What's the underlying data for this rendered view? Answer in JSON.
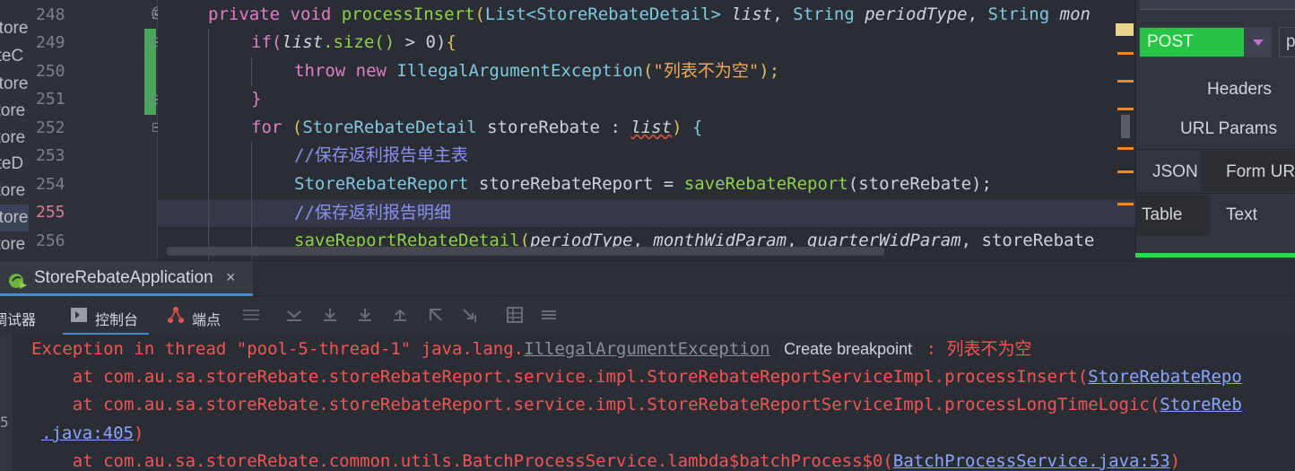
{
  "project_tree": {
    "items": [
      {
        "label": "Store",
        "selected": false
      },
      {
        "label": "ateC",
        "selected": false
      },
      {
        "label": "Store",
        "selected": false
      },
      {
        "label": "store",
        "selected": false
      },
      {
        "label": "store",
        "selected": false
      },
      {
        "label": "ateD",
        "selected": false
      },
      {
        "label": "store",
        "selected": false
      },
      {
        "label": "Store",
        "selected": true
      },
      {
        "label": "store",
        "selected": false
      }
    ]
  },
  "editor": {
    "line_numbers": [
      "248",
      "249",
      "250",
      "251",
      "252",
      "253",
      "254",
      "255",
      "256"
    ],
    "current_line": "255",
    "gutter_annotation": "@",
    "code": {
      "l248": {
        "kw": "private void",
        "fn": "processInsert",
        "open": "(",
        "type1": "List<StoreRebateDetail>",
        "p1": "list",
        "comma1": ",",
        "type2": "String",
        "p2": "periodType",
        "comma2": ",",
        "type3": "String",
        "p3": "mon"
      },
      "l249": {
        "kw": "if",
        "open": "(",
        "var": "list",
        "call": ".size()",
        "rest": " > 0)",
        "brace": "{"
      },
      "l250": {
        "kw": "throw new",
        "type": "IllegalArgumentException",
        "open": "(",
        "str": "\"列表不为空\"",
        "close": ");"
      },
      "l251": {
        "brace": "}"
      },
      "l252": {
        "kw": "for",
        "open": "(",
        "type": "StoreRebateDetail",
        "var": "storeRebate",
        "colon": ":",
        "iter": "list",
        "close": ")",
        "brace": "{"
      },
      "l253": {
        "comment": "//保存返利报告单主表"
      },
      "l254": {
        "type": "StoreRebateReport",
        "var": "storeRebateReport",
        "eq": "=",
        "fn": "saveRebateReport",
        "arg": "(storeRebate);"
      },
      "l255": {
        "comment": "//保存返利报告明细"
      },
      "l256": {
        "fn": "saveReportRebateDetail",
        "open": "(",
        "a1": "periodType",
        "a2": "monthWidParam",
        "a3": "quarterWidParam",
        "a4": "storeRebate"
      }
    }
  },
  "http_client": {
    "method": "POST",
    "url_partial": "p",
    "tabs_row1": [
      "Headers"
    ],
    "tabs_row2": [
      "URL Params"
    ],
    "body_tabs": [
      "JSON",
      "Form URL"
    ],
    "view_tabs": [
      "Table",
      "Text"
    ]
  },
  "run_window": {
    "tab_label": "StoreRebateApplication",
    "close_glyph": "×",
    "toolbar": {
      "debugger_label": "调试器",
      "console_label": "控制台",
      "endpoints_label": "端点"
    },
    "console": {
      "gutter_mark": "5",
      "line1": {
        "prefix": "Exception in thread \"pool-5-thread-1\" java.lang.",
        "exception": "IllegalArgumentException",
        "breakpoint": "Create breakpoint",
        "message": " : 列表不为空"
      },
      "line2": {
        "prefix": "    at com.au.sa.storeRebate.storeRebateReport.service.impl.StoreRebateReportServiceImpl.processInsert(",
        "link": "StoreRebateRepo"
      },
      "line3": {
        "prefix": "    at com.au.sa.storeRebate.storeRebateReport.service.impl.StoreRebateReportServiceImpl.processLongTimeLogic(",
        "link": "StoreReb"
      },
      "line4": {
        "link": ".java:405",
        "suffix": ")"
      },
      "line5": {
        "prefix": "    at com.au.sa.storeRebate.common.utils.BatchProcessService.lambda$batchProcess$0(",
        "link": "BatchProcessService.java:53",
        "suffix": ")"
      }
    }
  },
  "colors": {
    "keyword": "#e07fc4",
    "type": "#7ec8e0",
    "function": "#8fd14f",
    "string": "#f0a95a",
    "comment": "#8b8ff0",
    "error": "#f25555",
    "method_green": "#27c446"
  }
}
